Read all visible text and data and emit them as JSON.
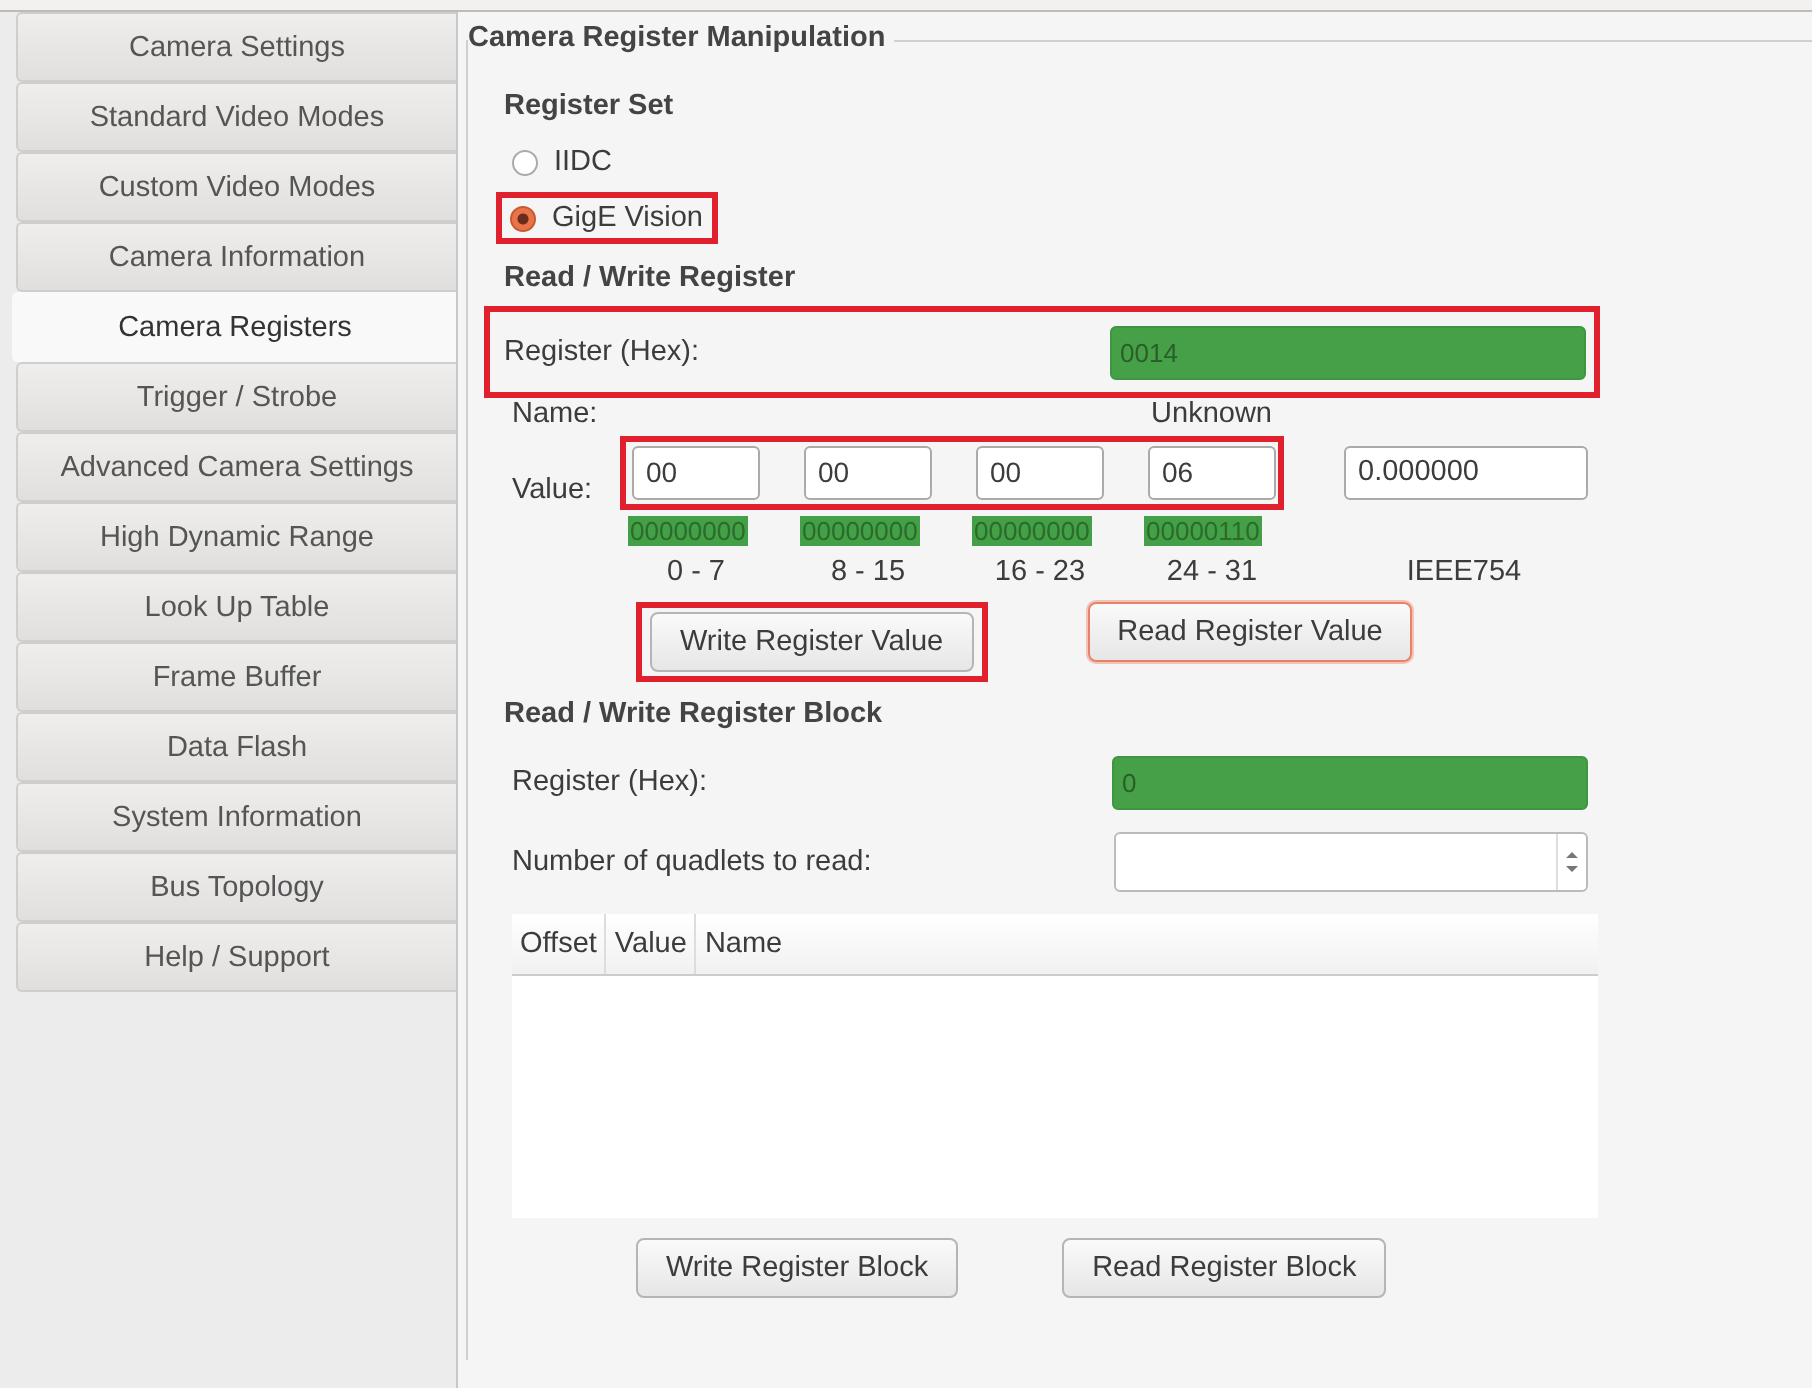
{
  "sidebar": {
    "items": [
      {
        "label": "Camera Settings",
        "selected": false
      },
      {
        "label": "Standard Video Modes",
        "selected": false
      },
      {
        "label": "Custom Video Modes",
        "selected": false
      },
      {
        "label": "Camera Information",
        "selected": false
      },
      {
        "label": "Camera Registers",
        "selected": true
      },
      {
        "label": "Trigger / Strobe",
        "selected": false
      },
      {
        "label": "Advanced Camera Settings",
        "selected": false
      },
      {
        "label": "High Dynamic Range",
        "selected": false
      },
      {
        "label": "Look Up Table",
        "selected": false
      },
      {
        "label": "Frame Buffer",
        "selected": false
      },
      {
        "label": "Data Flash",
        "selected": false
      },
      {
        "label": "System Information",
        "selected": false
      },
      {
        "label": "Bus Topology",
        "selected": false
      },
      {
        "label": "Help / Support",
        "selected": false
      }
    ]
  },
  "group_title": "Camera Register Manipulation",
  "register_set": {
    "heading": "Register Set",
    "options": [
      {
        "label": "IIDC",
        "selected": false,
        "highlighted": false
      },
      {
        "label": "GigE Vision",
        "selected": true,
        "highlighted": true
      }
    ]
  },
  "read_write_register": {
    "heading": "Read / Write Register",
    "register": {
      "label": "Register (Hex):",
      "value": "0014",
      "valid": true,
      "highlighted": true
    },
    "name_label": "Name:",
    "name_value": "Unknown",
    "value_label": "Value:",
    "bytes_highlighted": true,
    "bytes": [
      {
        "value": "00",
        "bits": "00000000",
        "range": "0 - 7"
      },
      {
        "value": "00",
        "bits": "00000000",
        "range": "8 - 15"
      },
      {
        "value": "00",
        "bits": "00000000",
        "range": "16 - 23"
      },
      {
        "value": "06",
        "bits": "00000110",
        "range": "24 - 31"
      }
    ],
    "float": {
      "value": "0.000000",
      "label": "IEEE754"
    },
    "buttons": [
      {
        "label": "Write Register Value",
        "highlighted": true,
        "focused": false
      },
      {
        "label": "Read Register Value",
        "highlighted": false,
        "focused": true
      }
    ]
  },
  "read_write_block": {
    "heading": "Read / Write Register Block",
    "register": {
      "label": "Register (Hex):",
      "value": "0",
      "valid": true
    },
    "quadlets": {
      "label": "Number of quadlets to read:"
    },
    "table": {
      "columns": [
        "Offset",
        "Value",
        "Name"
      ]
    },
    "buttons": [
      {
        "label": "Write Register Block"
      },
      {
        "label": "Read Register Block"
      }
    ]
  }
}
